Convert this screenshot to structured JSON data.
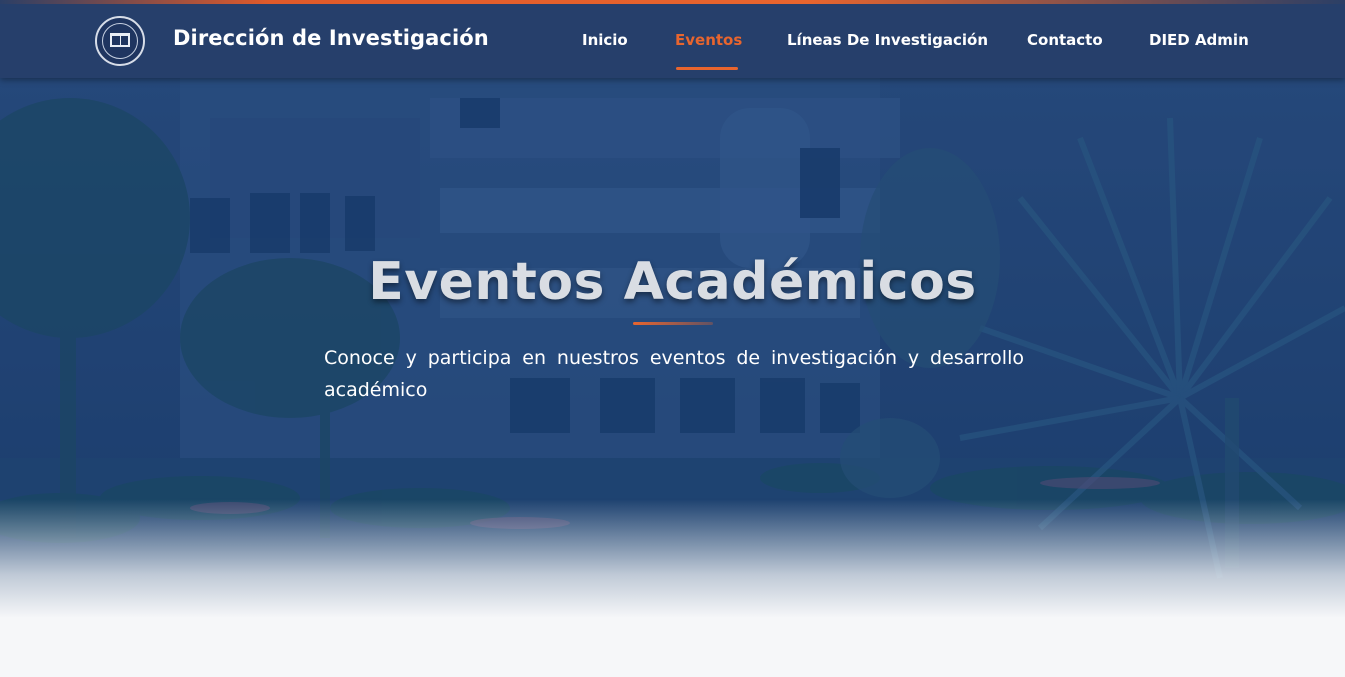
{
  "header": {
    "brand_title": "Dirección de Investigación",
    "logo_icon": "university-seal-icon",
    "nav": [
      {
        "label": "Inicio",
        "active": false
      },
      {
        "label": "Eventos",
        "active": true
      },
      {
        "label": "Líneas De Investigación",
        "active": false
      },
      {
        "label": "Contacto",
        "active": false
      },
      {
        "label": "DIED Admin",
        "active": false
      }
    ]
  },
  "hero": {
    "title": "Eventos Académicos",
    "subtitle": "Conoce y participa en nuestros eventos de investigación y desarrollo académico"
  },
  "colors": {
    "navbar": "#263f6b",
    "accent": "#e8652e",
    "hero_overlay": "#1d3f72",
    "page_background": "#f6f7f9"
  }
}
